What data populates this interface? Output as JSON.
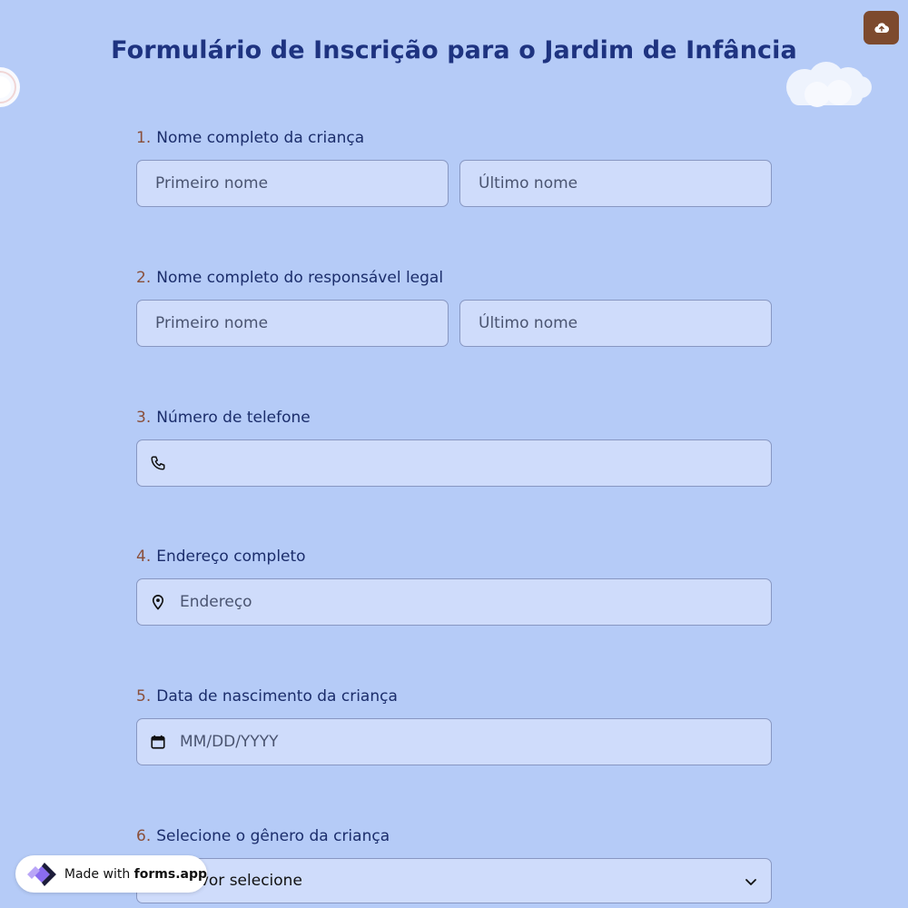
{
  "page": {
    "title": "Formulário de Inscrição para o Jardim de Infância",
    "upload_icon": "cloud-upload-icon",
    "accent_color": "#7d4a2e",
    "background_color": "#b5cbf7"
  },
  "questions": [
    {
      "number": "1.",
      "label": "Nome completo da criança",
      "fields": [
        {
          "placeholder": "Primeiro nome",
          "value": ""
        },
        {
          "placeholder": "Último nome",
          "value": ""
        }
      ]
    },
    {
      "number": "2.",
      "label": "Nome completo do responsável legal",
      "fields": [
        {
          "placeholder": "Primeiro nome",
          "value": ""
        },
        {
          "placeholder": "Último nome",
          "value": ""
        }
      ]
    },
    {
      "number": "3.",
      "label": "Número de telefone",
      "icon": "phone-icon",
      "placeholder": "",
      "value": ""
    },
    {
      "number": "4.",
      "label": "Endereço completo",
      "icon": "map-pin-icon",
      "placeholder": "Endereço",
      "value": ""
    },
    {
      "number": "5.",
      "label": "Data de nascimento da criança",
      "icon": "calendar-icon",
      "placeholder": "MM/DD/YYYY",
      "value": ""
    },
    {
      "number": "6.",
      "label": "Selecione o gênero da criança",
      "placeholder": "Por favor selecione",
      "icon": "chevron-down-icon"
    }
  ],
  "badge": {
    "prefix": "Made with",
    "brand": "forms.app",
    "icon": "forms-app-logo-icon"
  }
}
